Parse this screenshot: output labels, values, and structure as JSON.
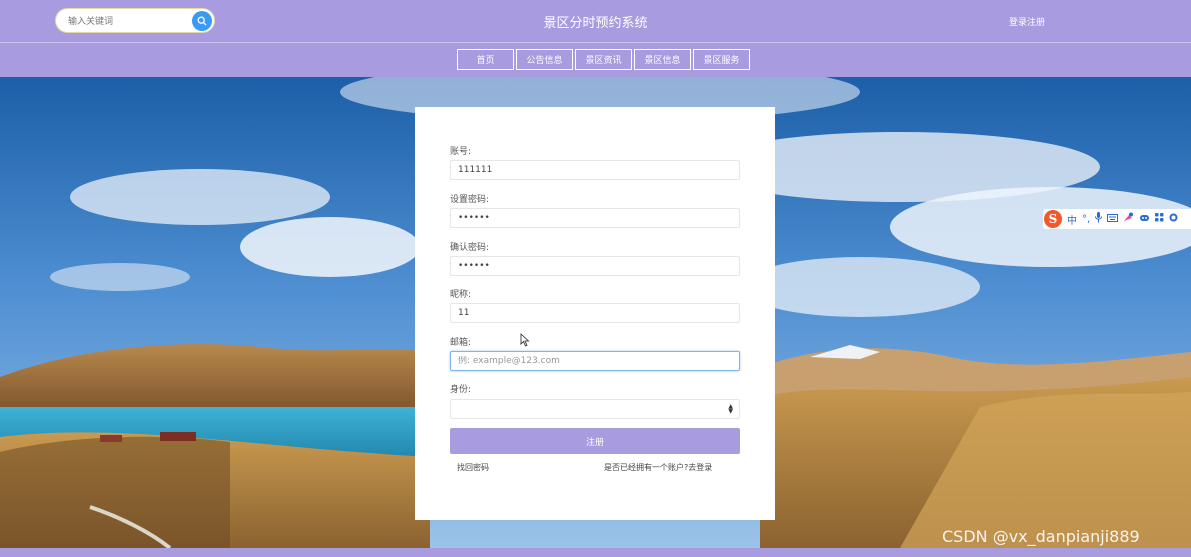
{
  "header": {
    "search_placeholder": "输入关键词",
    "title": "景区分时预约系统",
    "login_link": "登录注册"
  },
  "nav": {
    "items": [
      "首页",
      "公告信息",
      "景区资讯",
      "景区信息",
      "景区服务"
    ]
  },
  "form": {
    "account_label": "账号:",
    "account_value": "111111",
    "password_label": "设置密码:",
    "password_value": "••••••",
    "confirm_label": "确认密码:",
    "confirm_value": "••••••",
    "nickname_label": "昵称:",
    "nickname_value": "11",
    "email_label": "邮箱:",
    "email_placeholder": "例: example@123.com",
    "role_label": "身份:",
    "role_value": "",
    "submit_label": "注册",
    "forgot_link": "找回密码",
    "login_prompt": "是否已经拥有一个账户?去登录"
  },
  "ime": {
    "logo": "S",
    "mode": "中",
    "punct": "°,"
  },
  "watermark": "CSDN @vx_danpianji889",
  "colors": {
    "theme": "#a99be0",
    "search_button": "#3b9bf4",
    "ime_logo": "#f2592a"
  },
  "icons": {
    "search": "search-icon",
    "select": "chevron-updown-icon",
    "cursor": "mouse-pointer-icon"
  }
}
